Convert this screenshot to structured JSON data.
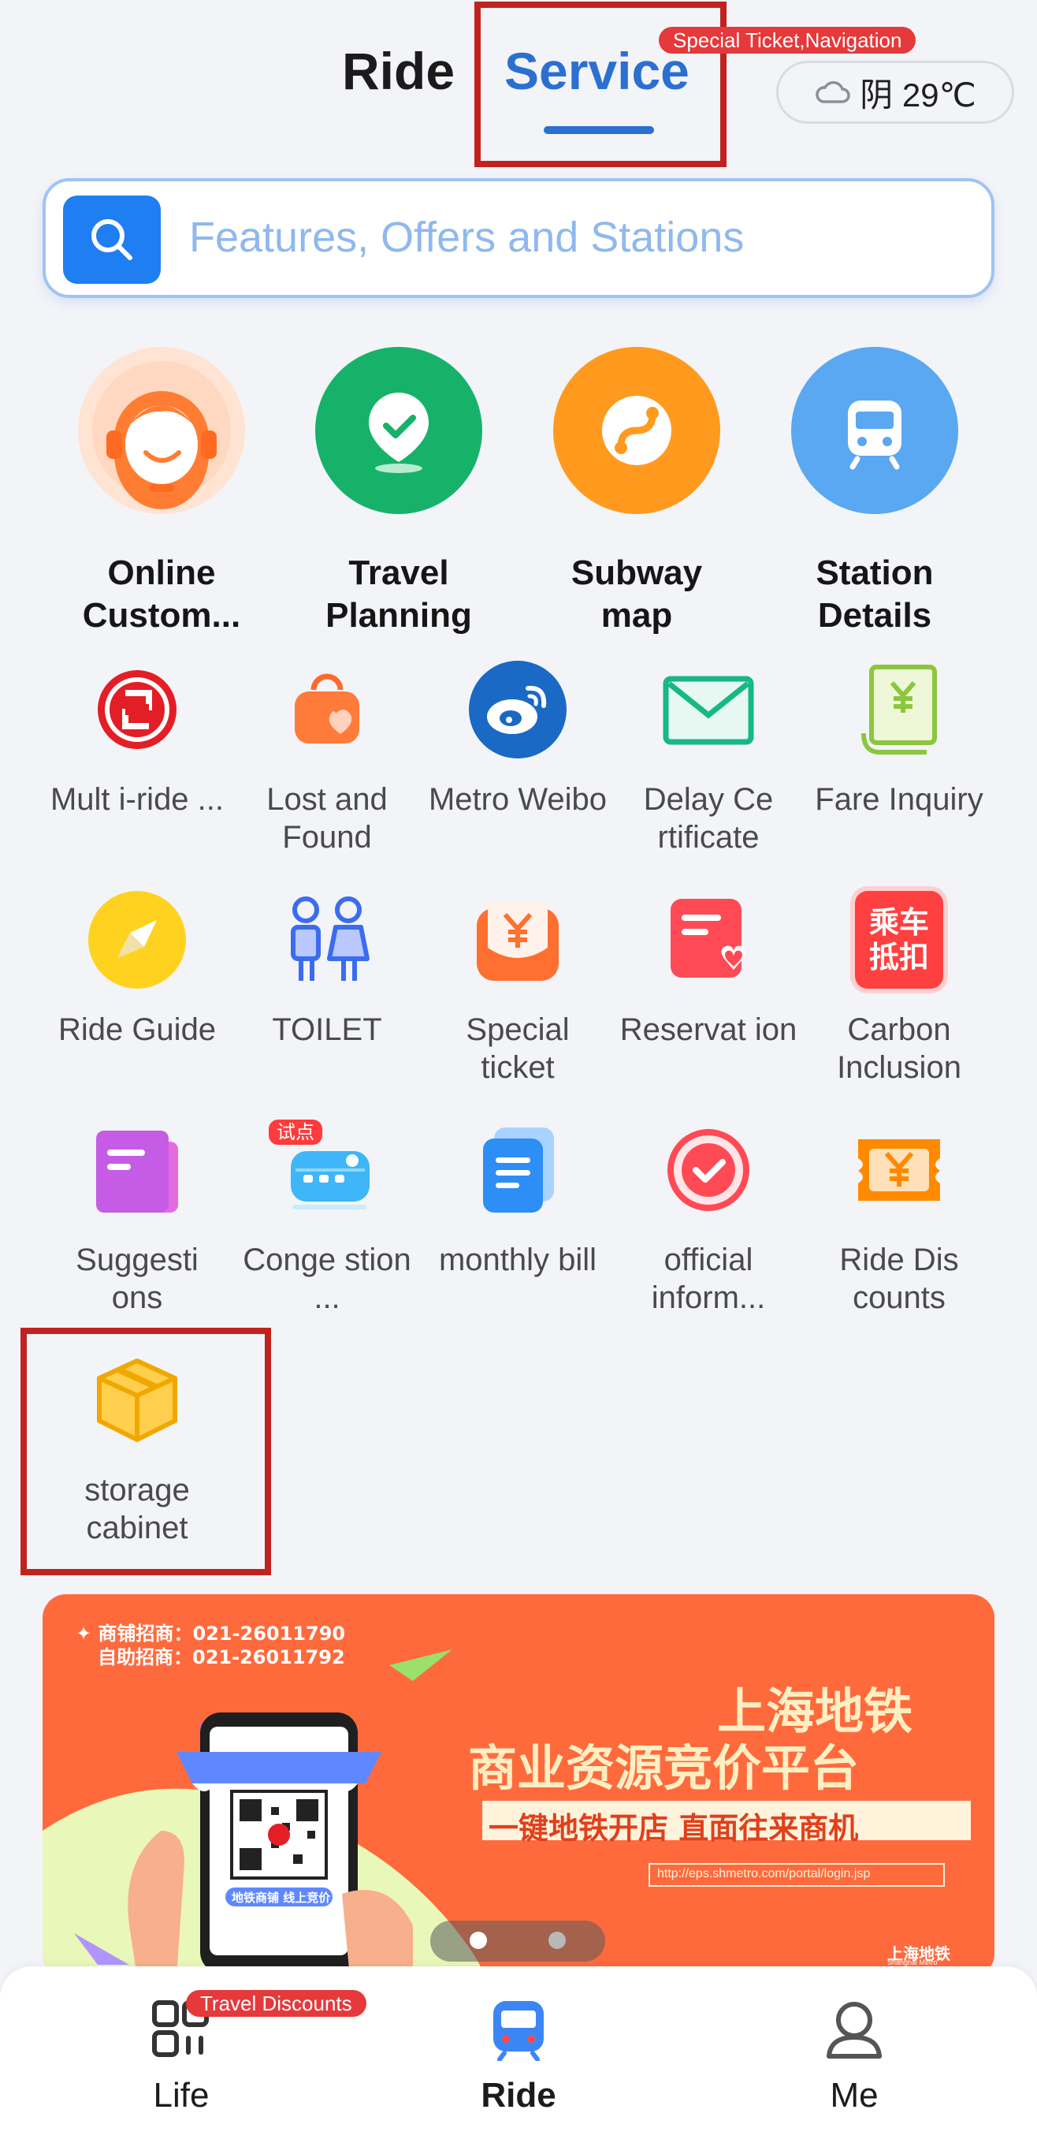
{
  "header": {
    "tab_ride": "Ride",
    "tab_service": "Service",
    "service_badge": "Special Ticket,Navigation",
    "weather": "阴 29℃",
    "weather_icon": "cloud-icon"
  },
  "search": {
    "placeholder": "Features, Offers and Stations",
    "icon": "search-icon"
  },
  "featured": [
    {
      "label": "Online Custom...",
      "icon": "customer-service-icon",
      "color": "#ff7d33"
    },
    {
      "label": "Travel Planning",
      "icon": "map-pin-icon",
      "color": "#17b26a"
    },
    {
      "label": "Subway map",
      "icon": "route-icon",
      "color": "#ff9a1f"
    },
    {
      "label": "Station Details",
      "icon": "train-icon",
      "color": "#5aa7f2"
    }
  ],
  "services": [
    {
      "label": "Mult i-ride ...",
      "icon": "multi-ride-icon"
    },
    {
      "label": "Lost and Found",
      "icon": "lost-found-bag-icon"
    },
    {
      "label": "Metro Weibo",
      "icon": "weibo-icon"
    },
    {
      "label": "Delay Ce rtificate",
      "icon": "envelope-icon"
    },
    {
      "label": "Fare Inquiry",
      "icon": "receipt-yen-icon"
    },
    {
      "label": "Ride Guide",
      "icon": "compass-icon"
    },
    {
      "label": "TOILET",
      "icon": "toilet-icon"
    },
    {
      "label": "Special ticket",
      "icon": "yen-ticket-icon"
    },
    {
      "label": "Reservat ion",
      "icon": "reservation-heart-icon"
    },
    {
      "label": "Carbon Inclusion",
      "icon": "carbon-badge-icon",
      "badge_text": "乘车抵扣"
    },
    {
      "label": "Suggesti ons",
      "icon": "suggestion-book-icon"
    },
    {
      "label": "Conge stion ...",
      "icon": "congestion-train-icon",
      "badge_text": "试点"
    },
    {
      "label": "monthly bill",
      "icon": "document-icon"
    },
    {
      "label": "official inform...",
      "icon": "verified-check-icon"
    },
    {
      "label": "Ride Dis counts",
      "icon": "coupon-yen-icon"
    },
    {
      "label": "storage cabinet",
      "icon": "box-icon"
    }
  ],
  "banner": {
    "line1": "✦ 商铺招商：021-26011790",
    "line2": "自助招商：021-26011792",
    "title1": "上海地铁",
    "title2": "商业资源竞价平台",
    "slogan": "一键地铁开店  直面往来商机",
    "url": "http://eps.shmetro.com/portal/login.jsp",
    "phone_caption": "地铁商铺 线上竞价",
    "logo_text": "上海地铁",
    "logo_sub": "Shanghai Metro",
    "page_index": 1,
    "page_count": 2
  },
  "nav": {
    "life": "Life",
    "ride": "Ride",
    "me": "Me",
    "life_badge": "Travel Discounts"
  }
}
